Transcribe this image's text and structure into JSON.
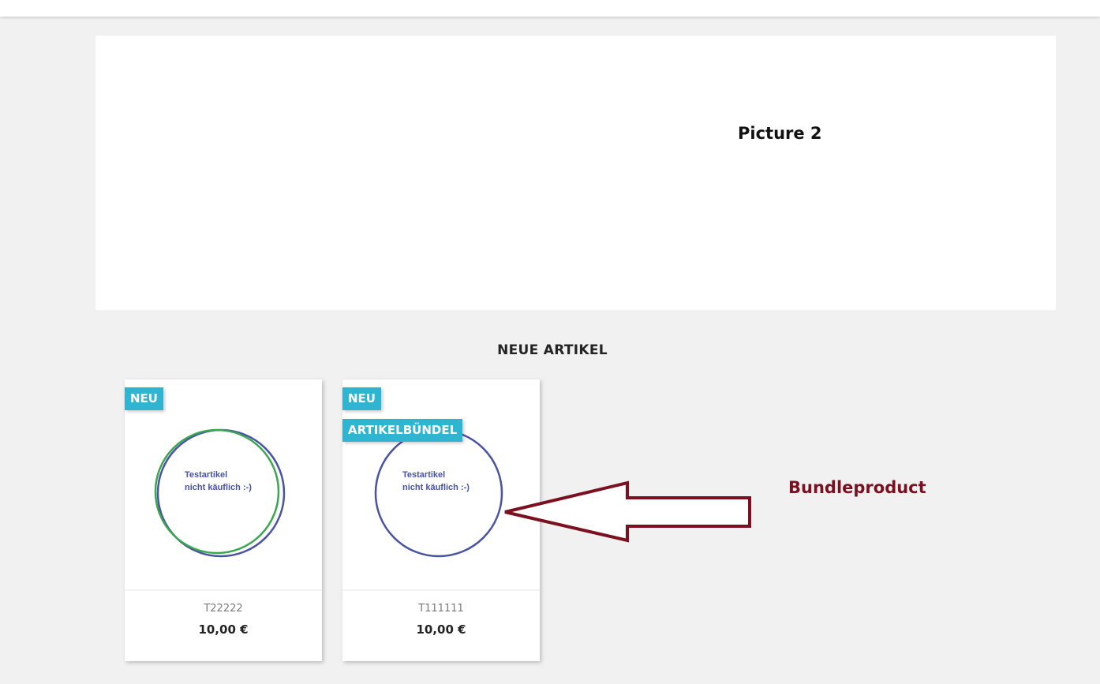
{
  "banner": {
    "label": "Picture 2"
  },
  "section": {
    "title": "NEUE ARTIKEL"
  },
  "products": [
    {
      "flag_new": "NEU",
      "image_text_line1": "Testartikel",
      "image_text_line2": "nicht käuflich :-)",
      "reference": "T22222",
      "price": "10,00 €"
    },
    {
      "flag_new": "NEU",
      "flag_pack": "ARTIKELBÜNDEL",
      "image_text_line1": "Testartikel",
      "image_text_line2": "nicht käuflich :-)",
      "reference": "T111111",
      "price": "10,00 €"
    }
  ],
  "annotation": {
    "label": "Bundleproduct"
  },
  "colors": {
    "flag_background": "#2fb5d2",
    "annotation": "#7a1020",
    "circle_blue": "#4a52a3",
    "circle_green": "#3aa64f"
  }
}
